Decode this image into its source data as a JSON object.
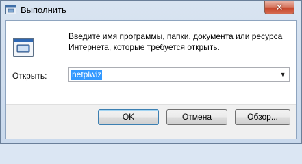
{
  "window": {
    "title": "Выполнить",
    "close_glyph": "✕",
    "icons": {
      "app": "run-app-icon",
      "close": "close-icon",
      "run": "run-program-icon"
    }
  },
  "dialog": {
    "description": "Введите имя программы, папки, документа или ресурса Интернета, которые требуется открыть.",
    "open_label": "Открыть:",
    "open_value": "netplwiz",
    "dropdown_glyph": "▼"
  },
  "buttons": {
    "ok": "OK",
    "cancel": "Отмена",
    "browse": "Обзор..."
  },
  "colors": {
    "selection": "#3399ff",
    "close_button": "#c7482d",
    "frame": "#c9d9ec"
  }
}
